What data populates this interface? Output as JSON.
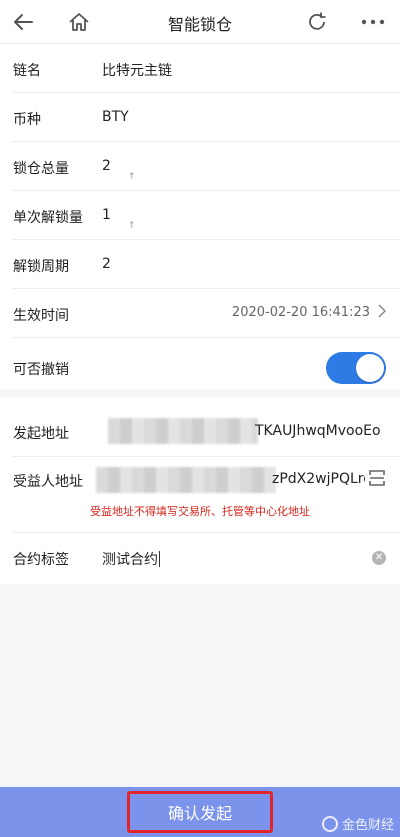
{
  "header": {
    "title": "智能锁仓",
    "icons": [
      "back-arrow-icon",
      "home-icon",
      "refresh-icon",
      "more-icon"
    ]
  },
  "form": {
    "chain_name": {
      "label": "链名",
      "value": "比特元主链"
    },
    "coin": {
      "label": "币种",
      "value": "BTY"
    },
    "total_lock": {
      "label": "锁仓总量",
      "value": "2"
    },
    "per_unlock": {
      "label": "单次解锁量",
      "value": "1"
    },
    "unlock_cycle": {
      "label": "解锁周期",
      "value": "2"
    },
    "effective_time": {
      "label": "生效时间",
      "value": "2020-02-20 16:41:23"
    },
    "revocable": {
      "label": "可否撤销",
      "enabled": true
    },
    "from_address": {
      "label": "发起地址",
      "value_visible": "TKAUJhwqMvooEo"
    },
    "beneficiary": {
      "label": "受益人地址",
      "value_visible": "zPdX2wjPQLro(",
      "warning": "受益地址不得填写交易所、托管等中心化地址"
    },
    "contract_tag": {
      "label": "合约标签",
      "value": "测试合约"
    }
  },
  "footer": {
    "confirm_label": "确认发起",
    "watermark": "金色财经"
  },
  "colors": {
    "accent": "#2e7be6",
    "bottom_bar": "#7b93ea",
    "warning": "#d9261c",
    "highlight_border": "#e0242b"
  }
}
